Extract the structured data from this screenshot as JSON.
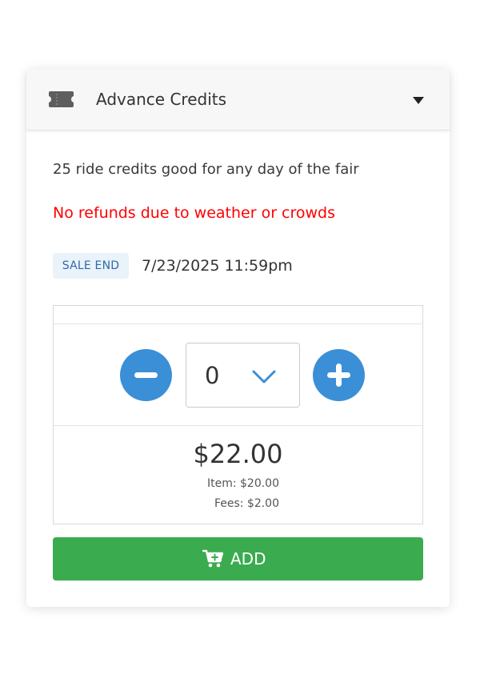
{
  "ticket": {
    "title": "Advance Credits",
    "description": "25 ride credits good for any day of the fair",
    "warning": "No refunds due to weather or crowds",
    "sale_end_label": "SALE END",
    "sale_end_date": "7/23/2025 11:59pm"
  },
  "quantity": {
    "value": "0",
    "decrement_icon": "minus-icon",
    "increment_icon": "plus-icon"
  },
  "pricing": {
    "total": "$22.00",
    "item": "Item: $20.00",
    "fees": "Fees: $2.00"
  },
  "add_button": {
    "label": "ADD",
    "icon": "cart-plus-icon"
  },
  "colors": {
    "accent_blue": "#3b8fd6",
    "add_green": "#3bab4f",
    "warning_red": "#ff0000",
    "badge_bg": "#eaf2fa",
    "badge_text": "#2f6aa8"
  }
}
